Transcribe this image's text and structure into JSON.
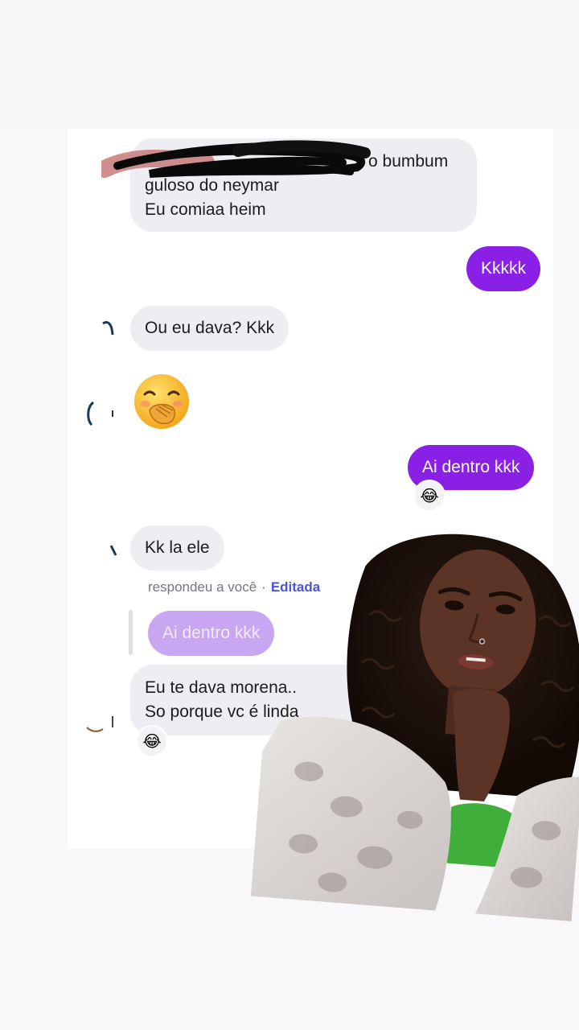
{
  "messages": {
    "m1": {
      "line1": "o bumbum",
      "line2": "guloso do neymar",
      "line3": "Eu comiaa heim"
    },
    "m2": "Kkkkk",
    "m3": "Ou eu dava? Kkk",
    "m4_emoji": "🤭",
    "m5": "Ai dentro kkk",
    "m5_reaction": "😂",
    "m6": "Kk la ele",
    "reply_meta": {
      "text": "respondeu a você",
      "separator": "·",
      "edited": "Editada"
    },
    "quoted": "Ai dentro kkk",
    "m7": {
      "line1": "Eu te dava morena..",
      "line2": "So porque vc é linda"
    },
    "m7_reaction": "😂"
  },
  "colors": {
    "outgoing": "#8a1fe6",
    "incoming": "#eeeef2",
    "quoted": "#c9a6f2",
    "edited_link": "#4a55d4"
  }
}
